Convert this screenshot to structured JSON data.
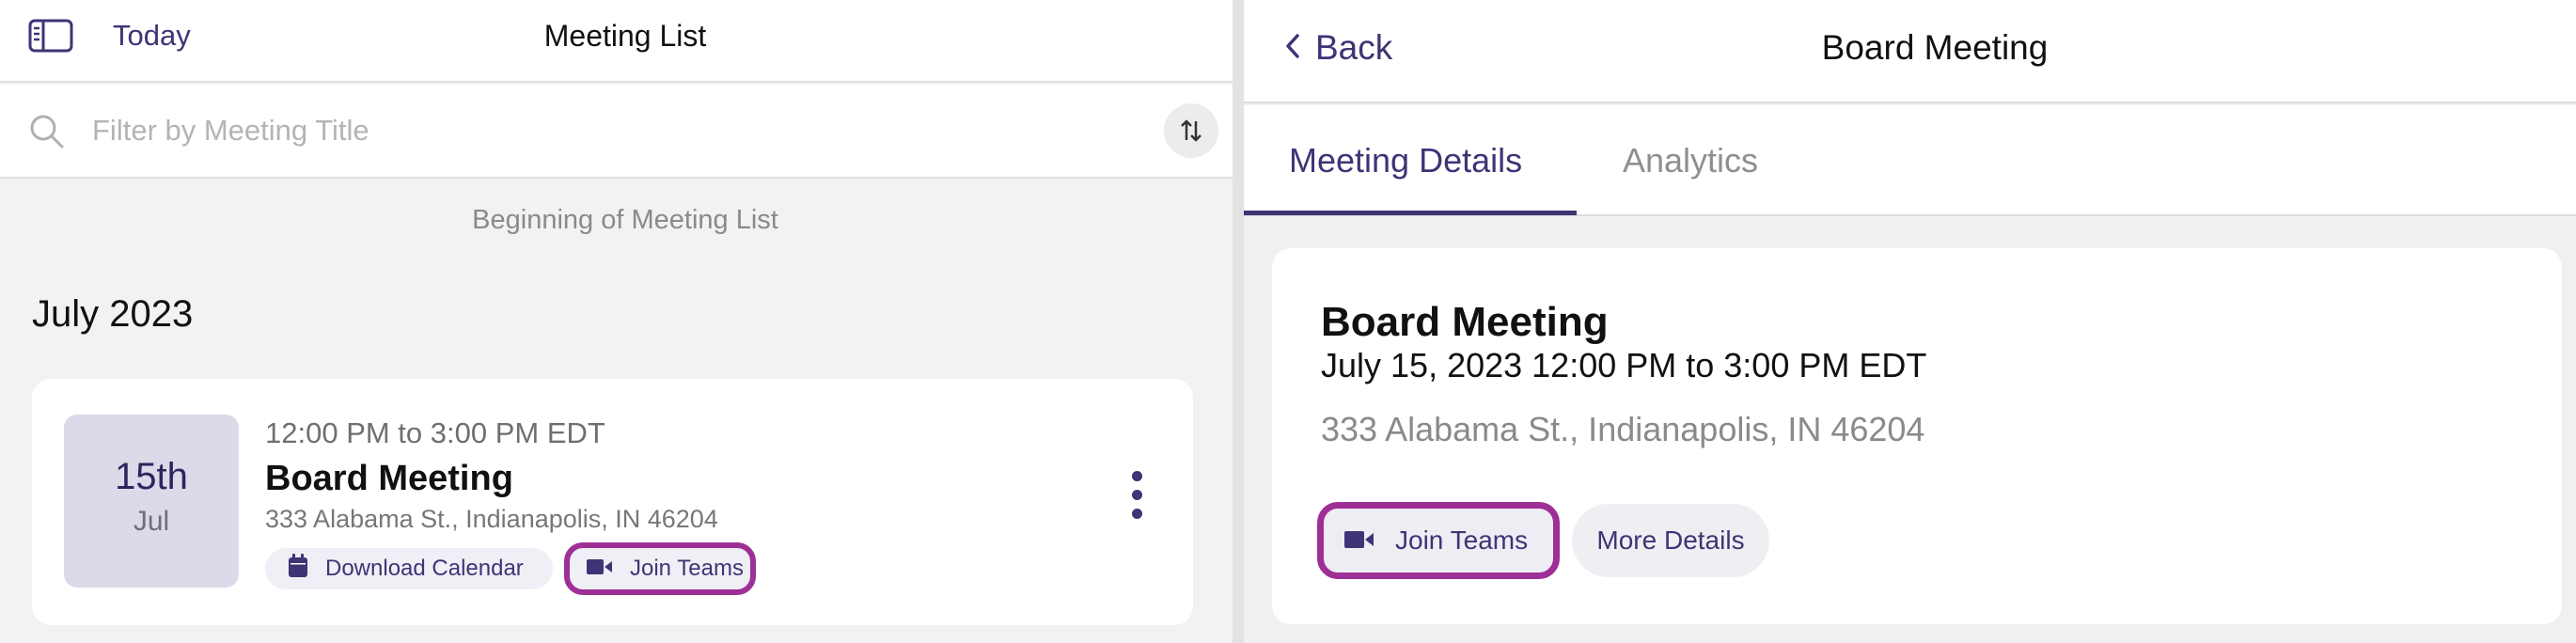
{
  "left": {
    "header": {
      "today_label": "Today",
      "title": "Meeting List"
    },
    "search": {
      "placeholder": "Filter by Meeting Title",
      "value": ""
    },
    "list_start_text": "Beginning of Meeting List",
    "month_heading": "July 2023",
    "meetings": [
      {
        "date_day": "15th",
        "date_month": "Jul",
        "time": "12:00 PM to 3:00 PM EDT",
        "title": "Board Meeting",
        "address": "333 Alabama St., Indianapolis, IN 46204",
        "download_label": "Download Calendar",
        "join_label": "Join Teams"
      }
    ]
  },
  "right": {
    "header": {
      "back_label": "Back",
      "title": "Board Meeting"
    },
    "tabs": [
      {
        "label": "Meeting Details",
        "active": true
      },
      {
        "label": "Analytics",
        "active": false
      }
    ],
    "detail": {
      "title": "Board Meeting",
      "datetime": "July 15, 2023 12:00 PM to 3:00 PM EDT",
      "address": "333 Alabama St., Indianapolis, IN 46204",
      "join_label": "Join Teams",
      "more_label": "More Details"
    }
  },
  "icons": {
    "sidebar": "sidebar-toggle-icon",
    "search": "search-icon",
    "sort": "sort-icon",
    "calendar": "calendar-icon",
    "video": "video-camera-icon",
    "kebab": "more-vertical-icon",
    "back": "chevron-left-icon"
  },
  "colors": {
    "accent": "#3e3476",
    "highlight_border": "#9d2f95",
    "date_badge_bg": "#dcdae8",
    "pane_bg": "#f2f2f2"
  }
}
